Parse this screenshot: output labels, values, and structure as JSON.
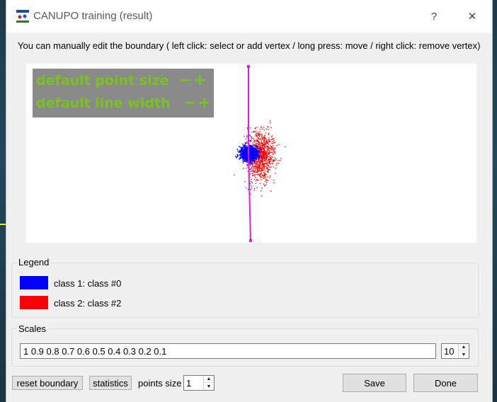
{
  "window": {
    "title": "CANUPO training (result)",
    "help_glyph": "?",
    "close_glyph": "✕"
  },
  "instructions": "You can manually edit the boundary ( left click: select or add vertex / long press: move / right click: remove vertex)",
  "plot_overlay": {
    "row1_label": "default point size",
    "row2_label": "default line width",
    "minus": "−",
    "plus": "+"
  },
  "legend": {
    "title": "Legend",
    "items": [
      {
        "label": "class 1: class #0",
        "color": "#0000ff"
      },
      {
        "label": "class 2: class #2",
        "color": "#ff0000"
      }
    ]
  },
  "scales": {
    "title": "Scales",
    "value": "1 0.9 0.8 0.7 0.6 0.5 0.4 0.3 0.2 0.1",
    "count": "10"
  },
  "footer": {
    "reset_label": "reset boundary",
    "stats_label": "statistics",
    "points_size_label": "points size",
    "points_size_value": "1",
    "save_label": "Save",
    "done_label": "Done"
  },
  "colors": {
    "boundary": "#e619e6",
    "class1": "#0000ff",
    "class2": "#ff0000",
    "overlay_text": "#7ac21e",
    "overlay_bg": "#8a8a8a"
  }
}
